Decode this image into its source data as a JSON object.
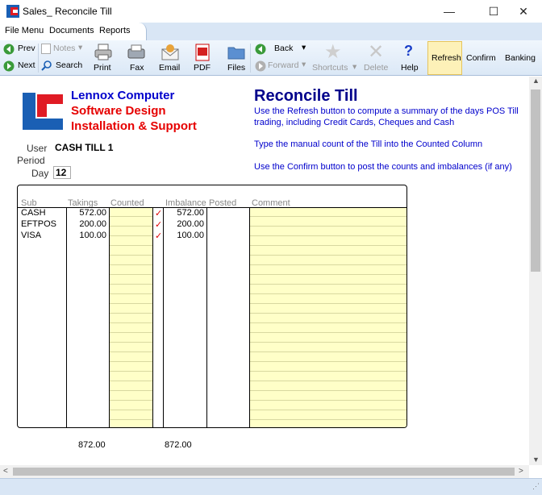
{
  "window": {
    "title": "Sales_ Reconcile Till",
    "minimize": "—",
    "maximize": "☐",
    "close": "✕"
  },
  "menu": {
    "items": [
      "File Menu",
      "Documents",
      "Reports"
    ]
  },
  "toolbar": {
    "prev": "Prev",
    "next": "Next",
    "notes": "Notes",
    "search": "Search",
    "print": "Print",
    "fax": "Fax",
    "email": "Email",
    "pdf": "PDF",
    "files": "Files",
    "back": "Back",
    "forward": "Forward",
    "shortcuts": "Shortcuts",
    "delete": "Delete",
    "help": "Help",
    "refresh": "Refresh",
    "confirm": "Confirm",
    "banking": "Banking"
  },
  "logo": {
    "line1": "Lennox Computer",
    "line2": "Software Design",
    "line3": "Installation & Support"
  },
  "header": {
    "title": "Reconcile Till",
    "info1": "Use the Refresh button to compute a summary of the days POS Till trading, including Credit Cards, Cheques and Cash",
    "info2": "Type the manual count of the Till into the Counted Column",
    "info3": "Use the Confirm button to post the counts and imbalances (if any)"
  },
  "form": {
    "user_label": "User",
    "user_value": "CASH TILL 1",
    "period_label": "Period",
    "day_label": "Day",
    "day_value": "12"
  },
  "grid": {
    "columns": {
      "sub": "Sub",
      "takings": "Takings",
      "counted": "Counted",
      "imbalance": "Imbalance",
      "posted": "Posted",
      "comment": "Comment"
    },
    "rows": [
      {
        "sub": "CASH",
        "takings": "572.00",
        "check": "✓",
        "imbalance": "572.00"
      },
      {
        "sub": "EFTPOS",
        "takings": "200.00",
        "check": "✓",
        "imbalance": "200.00"
      },
      {
        "sub": "VISA",
        "takings": "100.00",
        "check": "✓",
        "imbalance": "100.00"
      }
    ],
    "totals": {
      "takings": "872.00",
      "imbalance": "872.00"
    }
  },
  "colors": {
    "accent_blue": "#0000cc",
    "brand_red": "#e60000",
    "highlight_yellow": "#ffffc8",
    "toolbar_bg": "#dbe8f6"
  }
}
